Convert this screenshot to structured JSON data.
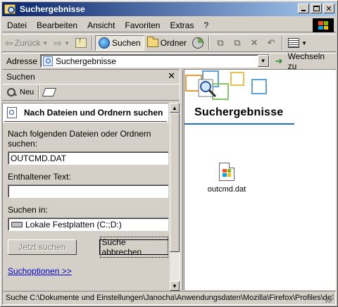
{
  "window": {
    "title": "Suchergebnisse"
  },
  "menu": [
    "Datei",
    "Bearbeiten",
    "Ansicht",
    "Favoriten",
    "Extras",
    "?"
  ],
  "toolbar": {
    "back_label": "Zurück",
    "search_label": "Suchen",
    "folders_label": "Ordner"
  },
  "address": {
    "label": "Adresse",
    "value": "Suchergebnisse",
    "go_label": "Wechseln zu"
  },
  "search_pane": {
    "header": "Suchen",
    "new_label": "Neu",
    "panel_title": "Nach Dateien und Ordnern suchen",
    "name_label": "Nach folgenden Dateien oder Ordnern suchen:",
    "name_value": "OUTCMD.DAT",
    "text_label": "Enthaltener Text:",
    "text_value": "",
    "lookin_label": "Suchen in:",
    "lookin_value": "Lokale Festplatten (C:;D:)",
    "search_now": "Jetzt suchen",
    "cancel_search": "Suche abbrechen",
    "options_link": "Suchoptionen >>"
  },
  "results": {
    "title": "Suchergebnisse",
    "files": [
      {
        "name": "outcmd.dat"
      }
    ]
  },
  "status": {
    "text": "Suche C:\\Dokumente und Einstellungen\\Janocha\\Anwendungsdaten\\Mozilla\\Firefox\\Profiles\\de"
  },
  "colors": {
    "titlebar_start": "#0a246a",
    "titlebar_end": "#a6caf0",
    "link": "#0000cc",
    "accent_line": "#1f6fc8"
  }
}
